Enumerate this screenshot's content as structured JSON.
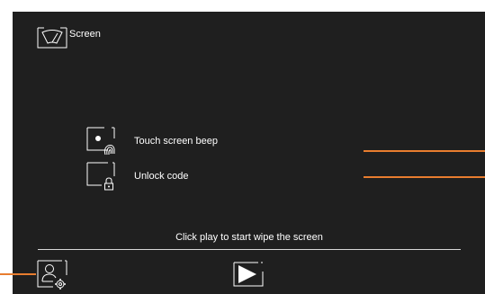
{
  "header": {
    "title": "Screen",
    "icon": "wiper-screen-icon"
  },
  "settings": [
    {
      "label": "Touch screen beep",
      "icon": "fingerprint-icon"
    },
    {
      "label": "Unlock code",
      "icon": "lock-icon"
    }
  ],
  "footer": {
    "hint": "Click play to start wipe the screen",
    "user_icon": "user-settings-icon",
    "play_icon": "play-icon"
  },
  "colors": {
    "screen_background": "#1f1f1f",
    "text": "#ffffff",
    "callout": "#e87d2f"
  }
}
